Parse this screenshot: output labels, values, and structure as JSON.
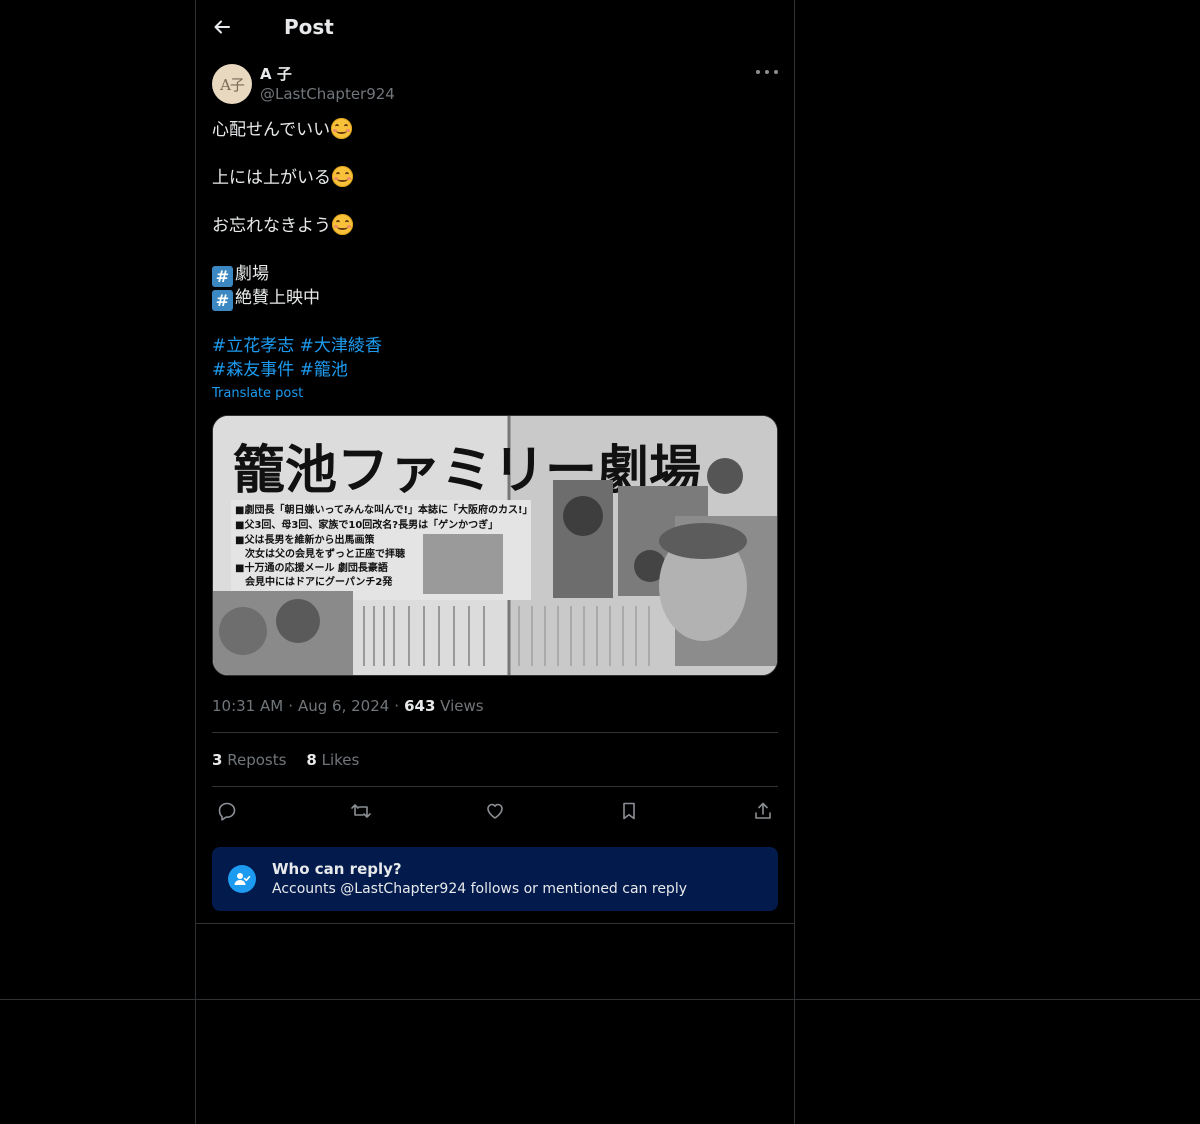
{
  "header": {
    "title": "Post"
  },
  "author": {
    "display_name": "A 子",
    "handle": "@LastChapter924",
    "avatar_text": "A子"
  },
  "post": {
    "lines": [
      "心配せんでいい",
      "上には上がいる",
      "お忘れなきよう"
    ],
    "hash_lines": [
      "劇場",
      "絶賛上映中"
    ],
    "hash_key_symbol": "#",
    "tags_row1": [
      "#立花孝志",
      "#大津綾香"
    ],
    "tags_row2": [
      "#森友事件",
      "#籠池"
    ],
    "translate_label": "Translate post"
  },
  "media": {
    "headline": "籠池ファミリー劇場",
    "bullets": [
      "■劇団長「朝日嫌いってみんな叫んで!」本誌に「大阪府のカス!」",
      "■父3回、母3回、家族で10回改名?長男は「ゲンかつぎ」",
      "■父は長男を維新から出馬画策",
      "次女は父の会見をずっと正座で拝聴",
      "■十万通の応援メール 劇団長豪語",
      "会見中にはドアにグーパンチ2発"
    ]
  },
  "meta": {
    "time": "10:31 AM",
    "date": "Aug 6, 2024",
    "views_count": "643",
    "views_label": "Views"
  },
  "stats": {
    "reposts_count": "3",
    "reposts_label": "Reposts",
    "likes_count": "8",
    "likes_label": "Likes"
  },
  "actions": [
    "reply-icon",
    "repost-icon",
    "like-icon",
    "bookmark-icon",
    "share-icon"
  ],
  "reply_settings": {
    "title": "Who can reply?",
    "subtitle": "Accounts @LastChapter924 follows or mentioned can reply"
  },
  "colors": {
    "link": "#1d9bf0",
    "background": "#000000",
    "border": "#2f3336",
    "muted": "#71767b",
    "reply_box": "#031a4d"
  }
}
